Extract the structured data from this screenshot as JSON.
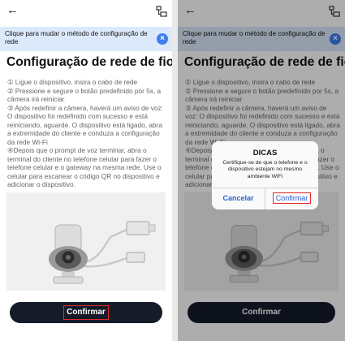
{
  "screen": {
    "banner_text": "Clique para mudar o método de configuração de rede",
    "title": "Configuração de rede de fio",
    "steps": [
      "① Ligue o dispositivo, insira o cabo de rede",
      "② Pressione e segure o botão predefinido por 5s, a câmera irá reiniciar",
      "③ Após redefinir a câmera, haverá um aviso de voz: O dispositivo foi redefinido com sucesso e está reiniciando, aguarde. O dispositivo está ligado, abra a extremidade do cliente e conduza a configuração da rede Wi-Fi",
      "④Depois que o prompt de voz terminar, abra o terminal do cliente no telefone celular para fazer o telefone celular e o gateway na mesma rede. Use o celular para escanear o código QR no dispositivo e adicionar o dispositivo."
    ],
    "confirm_label": "Confirmar",
    "back_icon": "←",
    "close_icon": "×"
  },
  "dialog": {
    "title": "DICAS",
    "message": "Certifique-se de que o telefone e o dispositivo estejam no mesmo ambiente WiFi",
    "cancel_label": "Cancelar",
    "confirm_label": "Confirmar"
  },
  "colors": {
    "accent": "#3d7ef0",
    "button_dark": "#161b2a",
    "highlight_box": "#e32b2b",
    "banner_bg": "#dbe9fb"
  }
}
